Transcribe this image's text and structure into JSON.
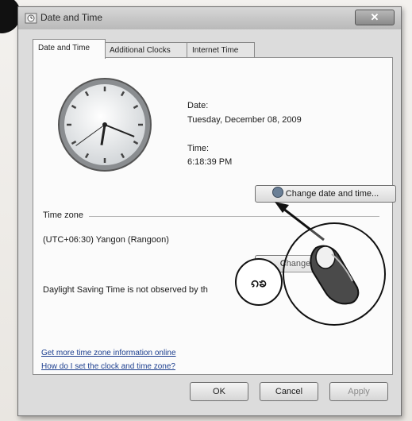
{
  "window": {
    "title": "Date and Time",
    "close_label": "✕"
  },
  "tabs": [
    {
      "label": "Date and Time",
      "active": true
    },
    {
      "label": "Additional Clocks",
      "active": false
    },
    {
      "label": "Internet Time",
      "active": false
    }
  ],
  "date_time": {
    "date_label": "Date:",
    "date_value": "Tuesday, December 08, 2009",
    "time_label": "Time:",
    "time_value": "6:18:39 PM",
    "change_button": "Change date and time...",
    "clock": {
      "hour": 6,
      "minute": 18,
      "second": 39
    }
  },
  "time_zone": {
    "section_label": "Time zone",
    "value": "(UTC+06:30) Yangon (Rangoon)",
    "change_button": "Change",
    "dst_note": "Daylight Saving Time is not observed by th"
  },
  "links": {
    "more_info": "Get more time zone information online",
    "how_to": "How do I set the clock and time zone?"
  },
  "footer": {
    "ok": "OK",
    "cancel": "Cancel",
    "apply": "Apply"
  },
  "callout": {
    "glyph": "ၵၶ"
  },
  "icons": [
    "clock-icon",
    "close-icon",
    "uac-shield-icon",
    "hand-pointer-icon",
    "arrow-icon"
  ]
}
